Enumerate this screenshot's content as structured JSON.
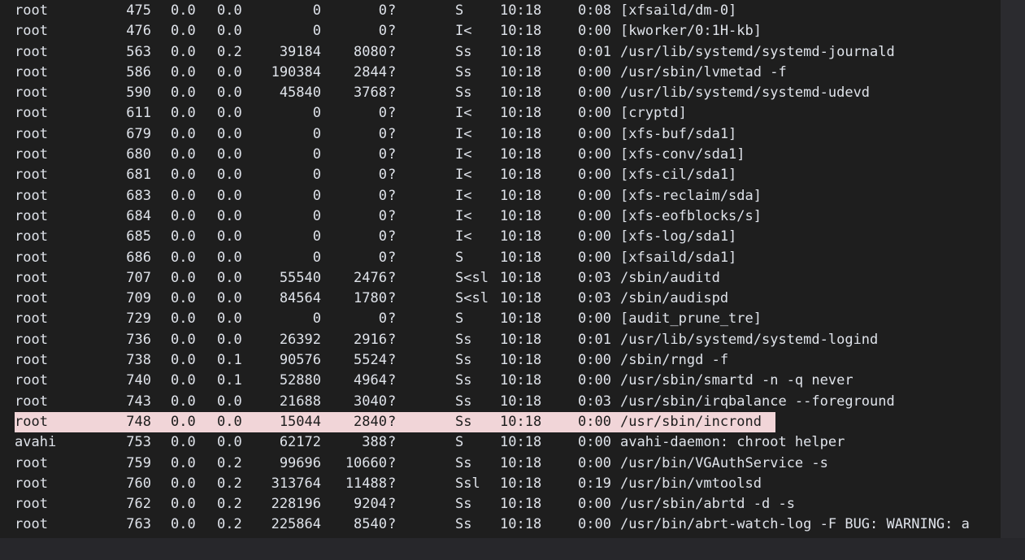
{
  "terminal": {
    "rows": [
      {
        "user": "root",
        "pid": "475",
        "cpu": "0.0",
        "mem": "0.0",
        "vsz": "0",
        "rss": "0",
        "tty": "?",
        "stat": "S",
        "start": "10:18",
        "time": "0:08",
        "command": "[xfsaild/dm-0]"
      },
      {
        "user": "root",
        "pid": "476",
        "cpu": "0.0",
        "mem": "0.0",
        "vsz": "0",
        "rss": "0",
        "tty": "?",
        "stat": "I<",
        "start": "10:18",
        "time": "0:00",
        "command": "[kworker/0:1H-kb]"
      },
      {
        "user": "root",
        "pid": "563",
        "cpu": "0.0",
        "mem": "0.2",
        "vsz": "39184",
        "rss": "8080",
        "tty": "?",
        "stat": "Ss",
        "start": "10:18",
        "time": "0:01",
        "command": "/usr/lib/systemd/systemd-journald"
      },
      {
        "user": "root",
        "pid": "586",
        "cpu": "0.0",
        "mem": "0.0",
        "vsz": "190384",
        "rss": "2844",
        "tty": "?",
        "stat": "Ss",
        "start": "10:18",
        "time": "0:00",
        "command": "/usr/sbin/lvmetad -f"
      },
      {
        "user": "root",
        "pid": "590",
        "cpu": "0.0",
        "mem": "0.0",
        "vsz": "45840",
        "rss": "3768",
        "tty": "?",
        "stat": "Ss",
        "start": "10:18",
        "time": "0:00",
        "command": "/usr/lib/systemd/systemd-udevd"
      },
      {
        "user": "root",
        "pid": "611",
        "cpu": "0.0",
        "mem": "0.0",
        "vsz": "0",
        "rss": "0",
        "tty": "?",
        "stat": "I<",
        "start": "10:18",
        "time": "0:00",
        "command": "[cryptd]"
      },
      {
        "user": "root",
        "pid": "679",
        "cpu": "0.0",
        "mem": "0.0",
        "vsz": "0",
        "rss": "0",
        "tty": "?",
        "stat": "I<",
        "start": "10:18",
        "time": "0:00",
        "command": "[xfs-buf/sda1]"
      },
      {
        "user": "root",
        "pid": "680",
        "cpu": "0.0",
        "mem": "0.0",
        "vsz": "0",
        "rss": "0",
        "tty": "?",
        "stat": "I<",
        "start": "10:18",
        "time": "0:00",
        "command": "[xfs-conv/sda1]"
      },
      {
        "user": "root",
        "pid": "681",
        "cpu": "0.0",
        "mem": "0.0",
        "vsz": "0",
        "rss": "0",
        "tty": "?",
        "stat": "I<",
        "start": "10:18",
        "time": "0:00",
        "command": "[xfs-cil/sda1]"
      },
      {
        "user": "root",
        "pid": "683",
        "cpu": "0.0",
        "mem": "0.0",
        "vsz": "0",
        "rss": "0",
        "tty": "?",
        "stat": "I<",
        "start": "10:18",
        "time": "0:00",
        "command": "[xfs-reclaim/sda]"
      },
      {
        "user": "root",
        "pid": "684",
        "cpu": "0.0",
        "mem": "0.0",
        "vsz": "0",
        "rss": "0",
        "tty": "?",
        "stat": "I<",
        "start": "10:18",
        "time": "0:00",
        "command": "[xfs-eofblocks/s]"
      },
      {
        "user": "root",
        "pid": "685",
        "cpu": "0.0",
        "mem": "0.0",
        "vsz": "0",
        "rss": "0",
        "tty": "?",
        "stat": "I<",
        "start": "10:18",
        "time": "0:00",
        "command": "[xfs-log/sda1]"
      },
      {
        "user": "root",
        "pid": "686",
        "cpu": "0.0",
        "mem": "0.0",
        "vsz": "0",
        "rss": "0",
        "tty": "?",
        "stat": "S",
        "start": "10:18",
        "time": "0:00",
        "command": "[xfsaild/sda1]"
      },
      {
        "user": "root",
        "pid": "707",
        "cpu": "0.0",
        "mem": "0.0",
        "vsz": "55540",
        "rss": "2476",
        "tty": "?",
        "stat": "S<sl",
        "start": "10:18",
        "time": "0:03",
        "command": "/sbin/auditd"
      },
      {
        "user": "root",
        "pid": "709",
        "cpu": "0.0",
        "mem": "0.0",
        "vsz": "84564",
        "rss": "1780",
        "tty": "?",
        "stat": "S<sl",
        "start": "10:18",
        "time": "0:03",
        "command": "/sbin/audispd"
      },
      {
        "user": "root",
        "pid": "729",
        "cpu": "0.0",
        "mem": "0.0",
        "vsz": "0",
        "rss": "0",
        "tty": "?",
        "stat": "S",
        "start": "10:18",
        "time": "0:00",
        "command": "[audit_prune_tre]"
      },
      {
        "user": "root",
        "pid": "736",
        "cpu": "0.0",
        "mem": "0.0",
        "vsz": "26392",
        "rss": "2916",
        "tty": "?",
        "stat": "Ss",
        "start": "10:18",
        "time": "0:01",
        "command": "/usr/lib/systemd/systemd-logind"
      },
      {
        "user": "root",
        "pid": "738",
        "cpu": "0.0",
        "mem": "0.1",
        "vsz": "90576",
        "rss": "5524",
        "tty": "?",
        "stat": "Ss",
        "start": "10:18",
        "time": "0:00",
        "command": "/sbin/rngd -f"
      },
      {
        "user": "root",
        "pid": "740",
        "cpu": "0.0",
        "mem": "0.1",
        "vsz": "52880",
        "rss": "4964",
        "tty": "?",
        "stat": "Ss",
        "start": "10:18",
        "time": "0:00",
        "command": "/usr/sbin/smartd -n -q never"
      },
      {
        "user": "root",
        "pid": "743",
        "cpu": "0.0",
        "mem": "0.0",
        "vsz": "21688",
        "rss": "3040",
        "tty": "?",
        "stat": "Ss",
        "start": "10:18",
        "time": "0:03",
        "command": "/usr/sbin/irqbalance --foreground"
      },
      {
        "user": "root",
        "pid": "748",
        "cpu": "0.0",
        "mem": "0.0",
        "vsz": "15044",
        "rss": "2840",
        "tty": "?",
        "stat": "Ss",
        "start": "10:18",
        "time": "0:00",
        "command": "/usr/sbin/incrond",
        "selected": true
      },
      {
        "user": "avahi",
        "pid": "753",
        "cpu": "0.0",
        "mem": "0.0",
        "vsz": "62172",
        "rss": "388",
        "tty": "?",
        "stat": "S",
        "start": "10:18",
        "time": "0:00",
        "command": "avahi-daemon: chroot helper"
      },
      {
        "user": "root",
        "pid": "759",
        "cpu": "0.0",
        "mem": "0.2",
        "vsz": "99696",
        "rss": "10660",
        "tty": "?",
        "stat": "Ss",
        "start": "10:18",
        "time": "0:00",
        "command": "/usr/bin/VGAuthService -s"
      },
      {
        "user": "root",
        "pid": "760",
        "cpu": "0.0",
        "mem": "0.2",
        "vsz": "313764",
        "rss": "11488",
        "tty": "?",
        "stat": "Ssl",
        "start": "10:18",
        "time": "0:19",
        "command": "/usr/bin/vmtoolsd"
      },
      {
        "user": "root",
        "pid": "762",
        "cpu": "0.0",
        "mem": "0.2",
        "vsz": "228196",
        "rss": "9204",
        "tty": "?",
        "stat": "Ss",
        "start": "10:18",
        "time": "0:00",
        "command": "/usr/sbin/abrtd -d -s"
      },
      {
        "user": "root",
        "pid": "763",
        "cpu": "0.0",
        "mem": "0.2",
        "vsz": "225864",
        "rss": "8540",
        "tty": "?",
        "stat": "Ss",
        "start": "10:18",
        "time": "0:00",
        "command": "/usr/bin/abrt-watch-log -F BUG: WARNING: a"
      }
    ]
  },
  "colors": {
    "background": "#1e1e1e",
    "text": "#dfe3ea",
    "selection": "#f1d5d8"
  }
}
